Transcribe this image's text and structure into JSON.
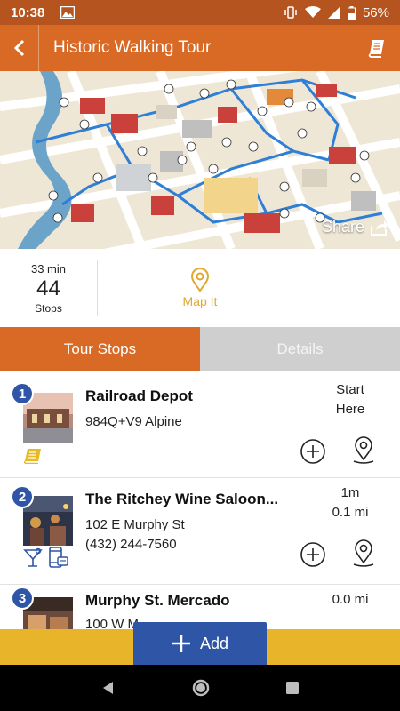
{
  "status_bar": {
    "time": "10:38",
    "battery": "56%"
  },
  "app_bar": {
    "title": "Historic Walking Tour"
  },
  "map": {
    "share_label": "Share"
  },
  "stats": {
    "duration": "33 min",
    "count": "44",
    "count_label": "Stops",
    "map_it_label": "Map It"
  },
  "tabs": [
    {
      "label": "Tour Stops",
      "active": true
    },
    {
      "label": "Details",
      "active": false
    }
  ],
  "stops": [
    {
      "number": "1",
      "name": "Railroad Depot",
      "line1": "984Q+V9 Alpine",
      "line2": "",
      "dist_line1": "Start",
      "dist_line2": "Here",
      "icons": [
        "book-icon"
      ]
    },
    {
      "number": "2",
      "name": "The Ritchey Wine Saloon...",
      "line1": "102 E Murphy St",
      "line2": "(432) 244-7560",
      "dist_line1": "1m",
      "dist_line2": "0.1 mi",
      "icons": [
        "cocktail-icon",
        "phone-icon"
      ]
    },
    {
      "number": "3",
      "name": "Murphy St. Mercado",
      "line1": "100 W M",
      "line2": "",
      "dist_line1": "0.0 mi",
      "dist_line2": "",
      "icons": []
    }
  ],
  "add_button": {
    "label": "Add"
  },
  "colors": {
    "primary": "#d96a25",
    "status": "#b5541f",
    "accent_blue": "#2f56a6",
    "gold": "#e7b42a"
  }
}
